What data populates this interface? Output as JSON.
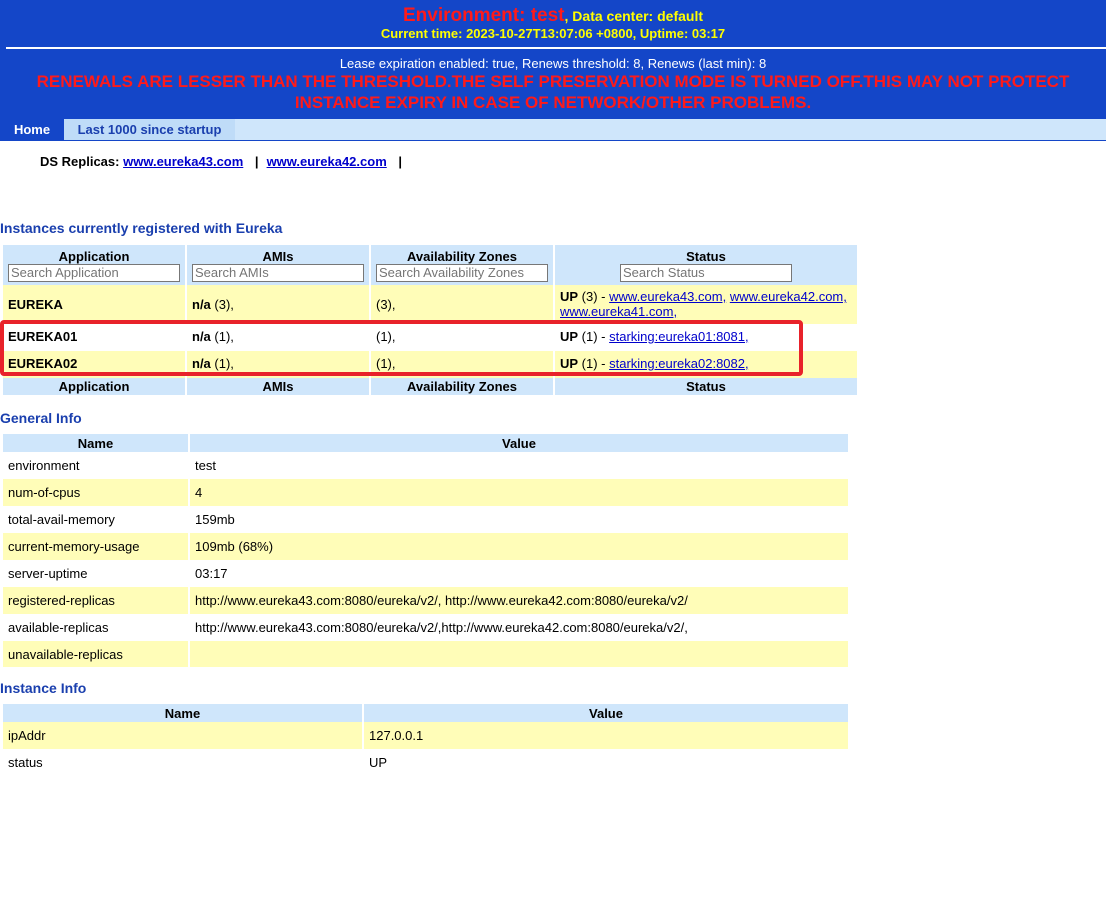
{
  "header": {
    "environment_label": "Environment: test",
    "data_center": ", Data center: default",
    "current_time": "Current time: 2023-10-27T13:07:06 +0800, Uptime: 03:17",
    "lease_line": "Lease expiration enabled: true, Renews threshold: 8, Renews (last min): 8",
    "warning_line1": "RENEWALS ARE LESSER THAN THE THRESHOLD.THE SELF PRESERVATION MODE IS TURNED OFF.THIS MAY NOT PROTECT",
    "warning_line2": "INSTANCE EXPIRY IN CASE OF NETWORK/OTHER PROBLEMS."
  },
  "nav": {
    "home": "Home",
    "last1000": "Last 1000 since startup"
  },
  "replicas": {
    "label": "DS Replicas:",
    "items": [
      "www.eureka43.com",
      "www.eureka42.com"
    ],
    "separator": "|"
  },
  "instances": {
    "title": "Instances currently registered with Eureka",
    "columns": [
      "Application",
      "AMIs",
      "Availability Zones",
      "Status"
    ],
    "placeholders": [
      "Search Application",
      "Search AMIs",
      "Search Availability Zones",
      "Search Status"
    ],
    "rows": [
      {
        "app": "EUREKA",
        "ami_name": "n/a",
        "ami_count": " (3),",
        "zones": "(3),",
        "status": "UP",
        "status_count": " (3) - ",
        "links": [
          "www.eureka43.com,",
          "www.eureka42.com,",
          "www.eureka41.com,"
        ]
      },
      {
        "app": "EUREKA01",
        "ami_name": "n/a",
        "ami_count": " (1),",
        "zones": "(1),",
        "status": "UP",
        "status_count": " (1) - ",
        "links": [
          "starking:eureka01:8081,"
        ]
      },
      {
        "app": "EUREKA02",
        "ami_name": "n/a",
        "ami_count": " (1),",
        "zones": "(1),",
        "status": "UP",
        "status_count": " (1) - ",
        "links": [
          "starking:eureka02:8082,"
        ]
      }
    ]
  },
  "general_info": {
    "title": "General Info",
    "columns": [
      "Name",
      "Value"
    ],
    "rows": [
      {
        "name": "environment",
        "value": "test"
      },
      {
        "name": "num-of-cpus",
        "value": "4"
      },
      {
        "name": "total-avail-memory",
        "value": "159mb"
      },
      {
        "name": "current-memory-usage",
        "value": "109mb (68%)"
      },
      {
        "name": "server-uptime",
        "value": "03:17"
      },
      {
        "name": "registered-replicas",
        "value": "http://www.eureka43.com:8080/eureka/v2/, http://www.eureka42.com:8080/eureka/v2/"
      },
      {
        "name": "available-replicas",
        "value": "http://www.eureka43.com:8080/eureka/v2/,http://www.eureka42.com:8080/eureka/v2/,"
      },
      {
        "name": "unavailable-replicas",
        "value": ""
      }
    ]
  },
  "instance_info": {
    "title": "Instance Info",
    "columns": [
      "Name",
      "Value"
    ],
    "rows": [
      {
        "name": "ipAddr",
        "value": "127.0.0.1"
      },
      {
        "name": "status",
        "value": "UP"
      }
    ]
  },
  "colors": {
    "header_bg": "#1446c8",
    "warning": "#ff1a1a",
    "header_text": "#ffff00",
    "row_highlight": "#fffdb8",
    "table_header": "#cfe6fb",
    "annotation_box": "#e8222a"
  }
}
